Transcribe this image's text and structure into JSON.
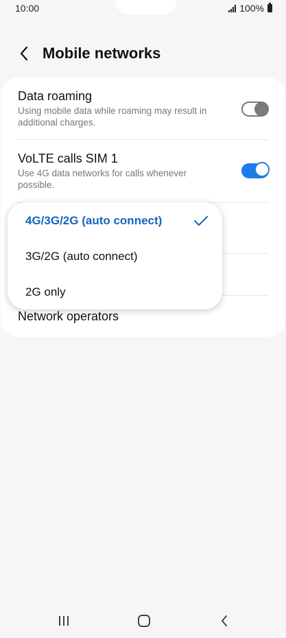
{
  "status_bar": {
    "time": "10:00",
    "battery_text": "100%"
  },
  "header": {
    "title": "Mobile networks"
  },
  "settings": {
    "data_roaming": {
      "title": "Data roaming",
      "subtitle": "Using mobile data while roaming may result in additional charges.",
      "enabled": false
    },
    "volte": {
      "title": "VoLTE calls SIM 1",
      "subtitle": "Use 4G data networks for calls whenever possible.",
      "enabled": true
    },
    "network_operators": {
      "title": "Network operators"
    }
  },
  "network_mode_menu": {
    "options": [
      {
        "label": "4G/3G/2G (auto connect)",
        "selected": true
      },
      {
        "label": "3G/2G (auto connect)",
        "selected": false
      },
      {
        "label": "2G only",
        "selected": false
      }
    ]
  },
  "colors": {
    "accent": "#1e7ce8",
    "selected_text": "#1565c0",
    "background": "#f6f6f6"
  },
  "icons": {
    "back": "chevron-left-icon",
    "check": "check-icon",
    "recents": "recents-icon",
    "home": "home-icon",
    "nav_back": "back-icon"
  }
}
